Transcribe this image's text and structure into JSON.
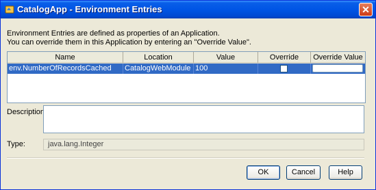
{
  "window": {
    "title": "CatalogApp - Environment Entries",
    "close_label": "✕"
  },
  "intro": {
    "line1": "Environment Entries are defined as properties of an Application.",
    "line2": "You can override them in this Application by entering an \"Override Value\"."
  },
  "table": {
    "columns": [
      "Name",
      "Location",
      "Value",
      "Override",
      "Override Value"
    ],
    "rows": [
      {
        "name": "env.NumberOfRecordsCached",
        "location": "CatalogWebModule",
        "value": "100",
        "override": false,
        "override_value": ""
      }
    ]
  },
  "description": {
    "label": "Description:",
    "value": ""
  },
  "type": {
    "label": "Type:",
    "value": "java.lang.Integer"
  },
  "buttons": {
    "ok": "OK",
    "cancel": "Cancel",
    "help": "Help"
  },
  "colors": {
    "titlebar": "#0055e5",
    "selection": "#316ac5",
    "dialog_bg": "#ece9d8"
  }
}
